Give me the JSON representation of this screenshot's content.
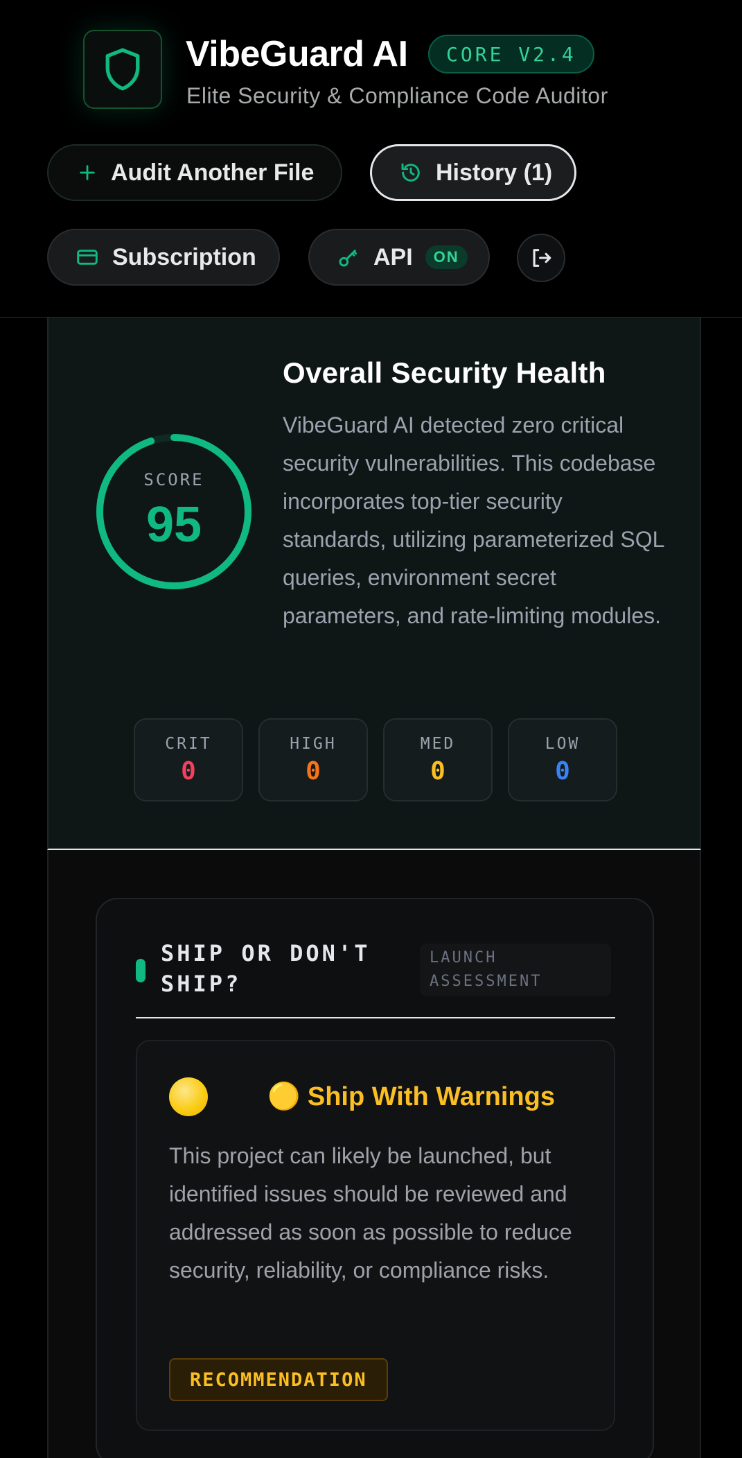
{
  "app": {
    "title": "VibeGuard AI",
    "version_badge": "CORE V2.4",
    "subtitle": "Elite Security & Compliance Code Auditor",
    "brand_color": "#10b981"
  },
  "toolbar": {
    "audit_label": "Audit Another File",
    "history_label": "History (1)",
    "subscription_label": "Subscription",
    "api_label": "API",
    "api_status": "ON",
    "icons": [
      "shield-icon",
      "plus-icon",
      "history-icon",
      "credit-card-icon",
      "key-icon",
      "logout-icon"
    ]
  },
  "health": {
    "title": "Overall Security Health",
    "description": "VibeGuard AI detected zero critical security vulnerabilities. This codebase incorporates top-tier security standards, utilizing parameterized SQL queries, environment secret parameters, and rate-limiting modules.",
    "score_label": "SCORE",
    "score": "95",
    "score_fraction": 0.95,
    "severity": [
      {
        "label": "CRIT",
        "count": "0",
        "color": "#f43f5e"
      },
      {
        "label": "HIGH",
        "count": "0",
        "color": "#f97316"
      },
      {
        "label": "MED",
        "count": "0",
        "color": "#fbbf24"
      },
      {
        "label": "LOW",
        "count": "0",
        "color": "#3b82f6"
      }
    ]
  },
  "ship": {
    "title": "SHIP OR DON'T SHIP?",
    "tag": "LAUNCH ASSESSMENT",
    "verdict_title": "🟡 Ship With Warnings",
    "verdict_description": "This project can likely be launched, but identified issues should be reviewed and addressed as soon as possible to reduce security, reliability, or compliance risks.",
    "recommendation_label": "RECOMMENDATION",
    "verdict_color": "#fbbf24"
  }
}
